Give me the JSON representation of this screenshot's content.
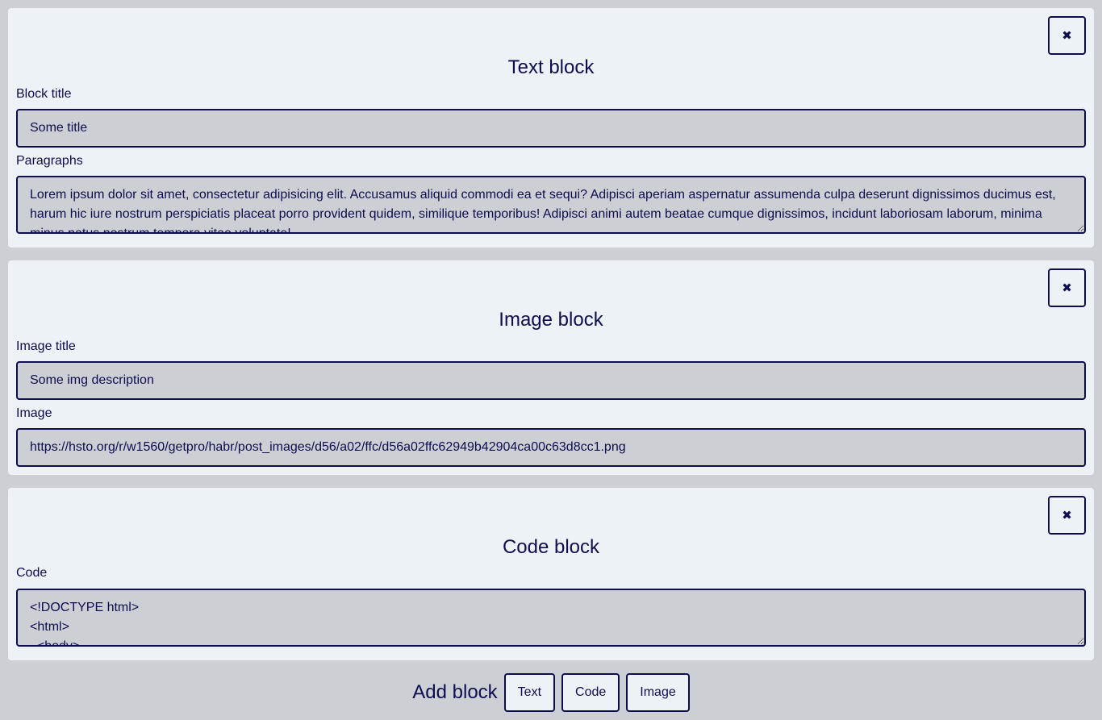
{
  "close_glyph": "✖",
  "text_block": {
    "heading": "Text block",
    "title_label": "Block title",
    "title_value": "Some title",
    "paragraphs_label": "Paragraphs",
    "paragraphs_value": "Lorem ipsum dolor sit amet, consectetur adipisicing elit. Accusamus aliquid commodi ea et sequi? Adipisci aperiam aspernatur assumenda culpa deserunt dignissimos ducimus est, harum hic iure nostrum perspiciatis placeat porro provident quidem, similique temporibus! Adipisci animi autem beatae cumque dignissimos, incidunt laboriosam laborum, minima minus natus nostrum tempora vitae voluptate!"
  },
  "image_block": {
    "heading": "Image block",
    "title_label": "Image title",
    "title_value": "Some img description",
    "image_label": "Image",
    "image_value": "https://hsto.org/r/w1560/getpro/habr/post_images/d56/a02/ffc/d56a02ffc62949b42904ca00c63d8cc1.png"
  },
  "code_block": {
    "heading": "Code block",
    "code_label": "Code",
    "code_value": "<!DOCTYPE html>\n<html>\n  <body>\n  </body>\n</html>"
  },
  "add_block": {
    "label": "Add block",
    "buttons": [
      "Text",
      "Code",
      "Image"
    ]
  }
}
